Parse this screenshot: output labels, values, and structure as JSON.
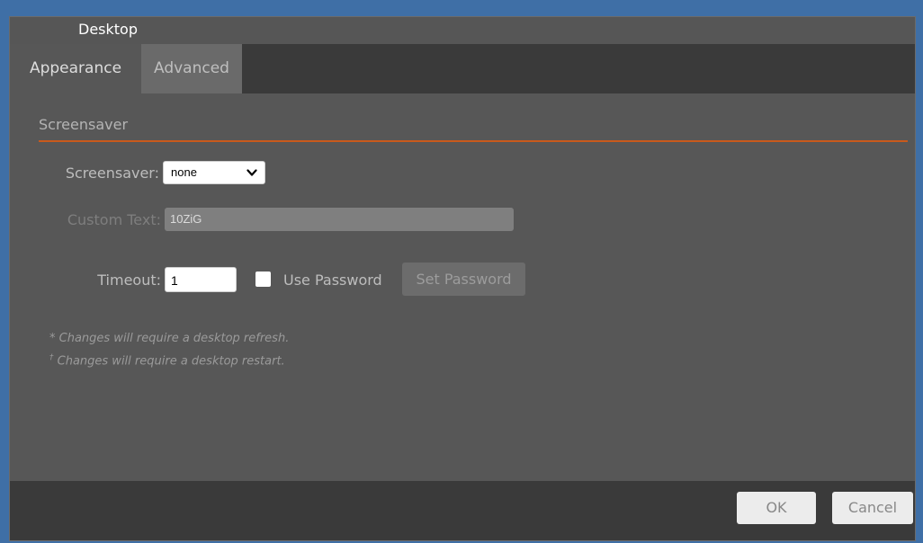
{
  "window": {
    "title": "Desktop"
  },
  "tabs": [
    {
      "label": "Appearance",
      "active": true
    },
    {
      "label": "Advanced",
      "active": false
    }
  ],
  "section": {
    "title": "Screensaver"
  },
  "form": {
    "screensaver_label": "Screensaver:",
    "screensaver_value": "none",
    "custom_text_label": "Custom Text:",
    "custom_text_value": "10ZiG",
    "timeout_label": "Timeout:",
    "timeout_value": "1",
    "use_password_label": "Use Password",
    "use_password_checked": false,
    "set_password_label": "Set Password"
  },
  "notes": {
    "refresh": "* Changes will require a desktop refresh.",
    "restart_marker": "†",
    "restart": " Changes will require a desktop restart."
  },
  "footer": {
    "ok_label": "OK",
    "cancel_label": "Cancel"
  },
  "colors": {
    "accent": "#c95a1c",
    "background": "#575757",
    "desktop": "#3f6fa6"
  },
  "icons": {
    "select_arrow": "chevron-down-icon"
  }
}
